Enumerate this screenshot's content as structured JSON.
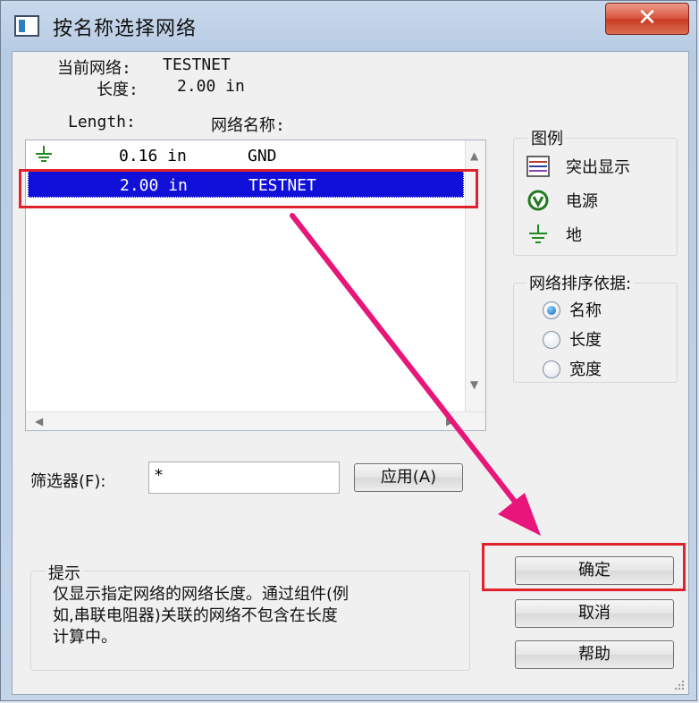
{
  "window": {
    "title": "按名称选择网络",
    "close_glyph": "✕"
  },
  "current_net": {
    "net_label": "当前网络:",
    "net_value": "TESTNET",
    "length_label": "长度:",
    "length_value": "2.00 in"
  },
  "list": {
    "col_length": "Length:",
    "col_name": "网络名称:",
    "rows": [
      {
        "length": "0.16 in",
        "name": "GND",
        "icon": "ground-icon",
        "selected": false
      },
      {
        "length": "2.00 in",
        "name": "TESTNET",
        "icon": "",
        "selected": true
      }
    ]
  },
  "legend": {
    "title": "图例",
    "items": [
      {
        "label": "突出显示",
        "icon": "highlight-icon"
      },
      {
        "label": "电源",
        "icon": "power-icon"
      },
      {
        "label": "地",
        "icon": "ground-icon"
      }
    ]
  },
  "sort": {
    "title": "网络排序依据:",
    "options": [
      {
        "label": "名称",
        "selected": true
      },
      {
        "label": "长度",
        "selected": false
      },
      {
        "label": "宽度",
        "selected": false
      }
    ]
  },
  "filter": {
    "label": "筛选器(F):",
    "value": "*",
    "apply_label": "应用(A)"
  },
  "hint": {
    "title": "提示",
    "line1": "仅显示指定网络的网络长度。通过组件(例",
    "line2": "如,串联电阻器)关联的网络不包含在长度",
    "line3": "计算中。"
  },
  "buttons": {
    "ok": "确定",
    "cancel": "取消",
    "help": "帮助"
  },
  "colors": {
    "selection": "#1010d8",
    "annotation_red": "#e0222d",
    "annotation_arrow": "#e8157a"
  }
}
